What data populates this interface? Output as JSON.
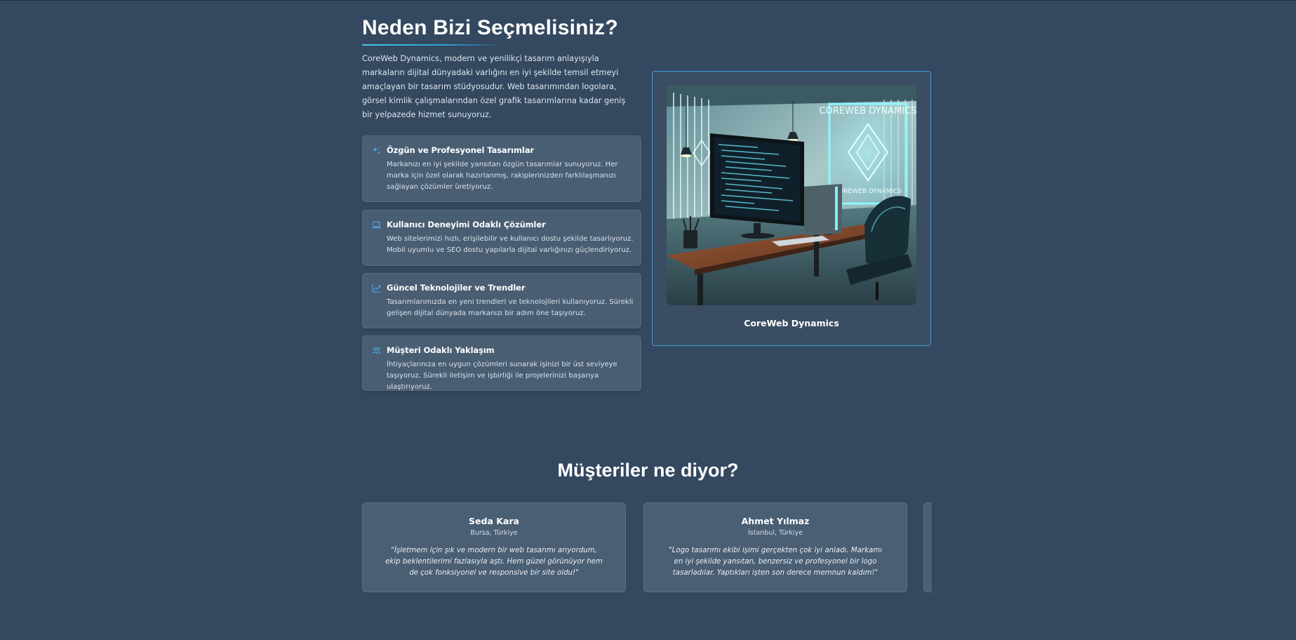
{
  "why": {
    "title": "Neden Bizi Seçmelisiniz?",
    "intro": "CoreWeb Dynamics, modern ve yenilikçi tasarım anlayışıyla markaların dijital dünyadaki varlığını en iyi şekilde temsil etmeyi amaçlayan bir tasarım stüdyosudur. Web tasarımından logolara, görsel kimlik çalışmalarından özel grafik tasarımlarına kadar geniş bir yelpazede hizmet sunuyoruz.",
    "features": [
      {
        "icon": "sparkle-icon",
        "title": "Özgün ve Profesyonel Tasarımlar",
        "desc": "Markanızı en iyi şekilde yansıtan özgün tasarımlar sunuyoruz. Her marka için özel olarak hazırlanmış, rakiplerinizden farklılaşmanızı sağlayan çözümler üretiyoruz."
      },
      {
        "icon": "laptop-icon",
        "title": "Kullanıcı Deneyimi Odaklı Çözümler",
        "desc": "Web sitelerimizi hızlı, erişilebilir ve kullanıcı dostu şekilde tasarlıyoruz. Mobil uyumlu ve SEO dostu yapılarla dijital varlığınızı güçlendiriyoruz."
      },
      {
        "icon": "trend-chart-icon",
        "title": "Güncel Teknolojiler ve Trendler",
        "desc": "Tasarımlarımızda en yeni trendleri ve teknolojileri kullanıyoruz. Sürekli gelişen dijital dünyada markanızı bir adım öne taşıyoruz."
      },
      {
        "icon": "users-icon",
        "title": "Müşteri Odaklı Yaklaşım",
        "desc": "İhtiyaçlarınıza en uygun çözümleri sunarak işinizi bir üst seviyeye taşıyoruz. Sürekli iletişim ve işbirliği ile projelerinizi başarıya ulaştırıyoruz."
      }
    ]
  },
  "image_card": {
    "caption": "CoreWeb Dynamics",
    "neon_sign_top": "COREWEB DYNAMICS",
    "neon_sign_bottom": "COREWEB DYNAMICS"
  },
  "testimonials": {
    "title": "Müşteriler ne diyor?",
    "items": [
      {
        "name": "Seda Kara",
        "location": "Bursa, Türkiye",
        "quote": "\"İşletmem için şık ve modern bir web tasarımı arıyordum, ekip beklentilerimi fazlasıyla aştı. Hem güzel görünüyor hem de çok fonksiyonel ve responsive bir site oldu!\""
      },
      {
        "name": "Ahmet Yılmaz",
        "location": "İstanbul, Türkiye",
        "quote": "\"Logo tasarımı ekibi işimi gerçekten çok iyi anladı. Markamı en iyi şekilde yansıtan, benzersiz ve profesyonel bir logo tasarladılar. Yaptıkları işten son derece memnun kaldım!\""
      }
    ]
  },
  "colors": {
    "background": "#34485f",
    "card": "#495d73",
    "accent": "#3d9ee0",
    "icon": "#4aa8e0"
  }
}
